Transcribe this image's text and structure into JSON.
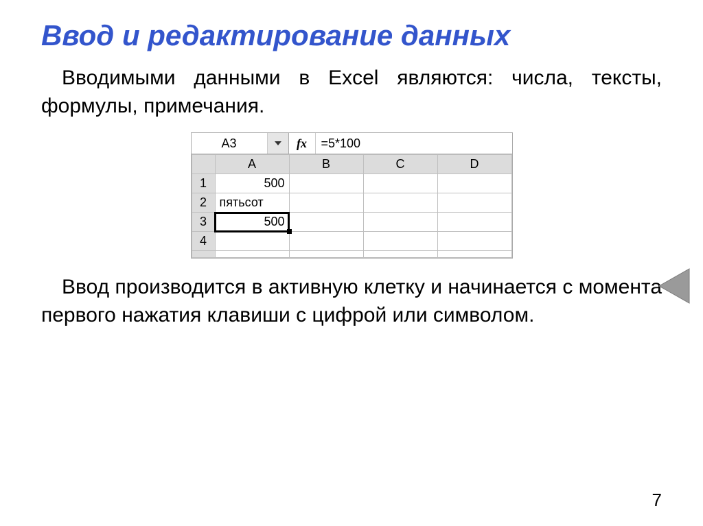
{
  "title": "Ввод и редактирование данных",
  "paragraph1": "Вводимыми данными в Excel являются: числа, тексты, формулы, примечания.",
  "paragraph2": "Ввод производится в активную клетку и начинается с момента первого нажатия клавиши с цифрой или символом.",
  "page_number": "7",
  "excel": {
    "namebox": "A3",
    "fx_label": "fx",
    "formula": "=5*100",
    "columns": [
      "A",
      "B",
      "C",
      "D"
    ],
    "rows": [
      "1",
      "2",
      "3",
      "4"
    ],
    "cells": {
      "A1": "500",
      "A2": "пятьсот",
      "A3": "500"
    }
  }
}
